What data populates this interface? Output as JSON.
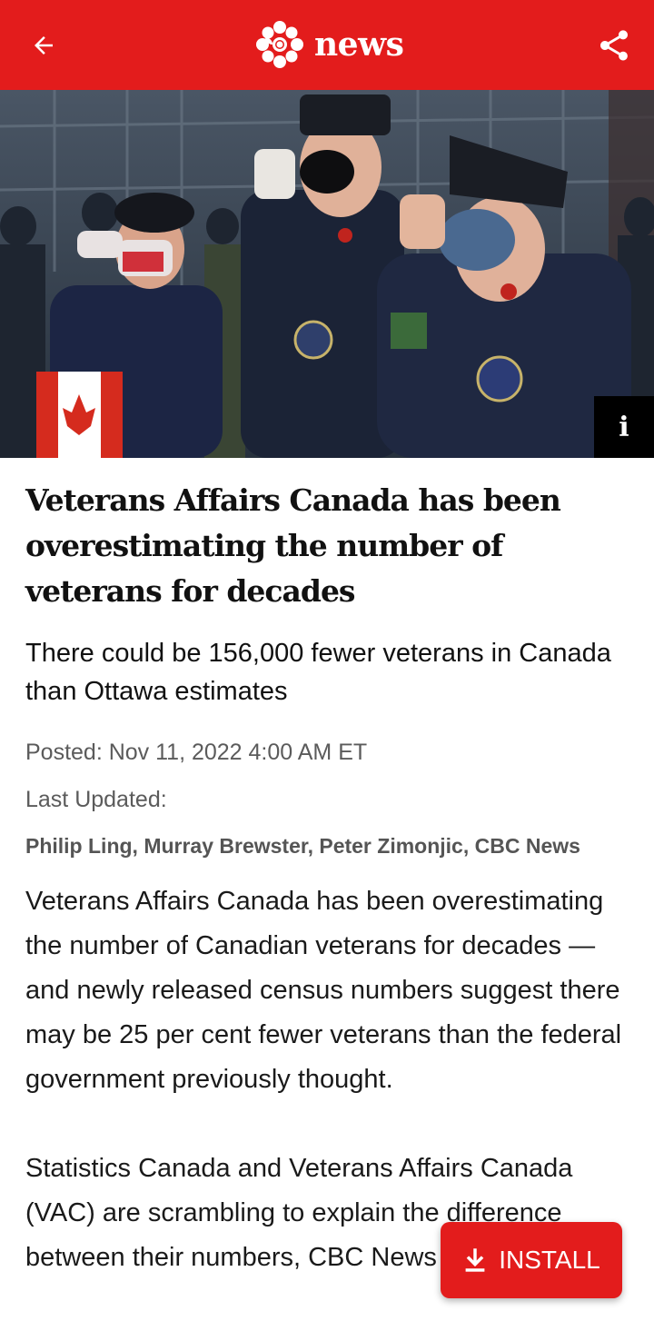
{
  "header": {
    "brand": "news",
    "back_icon": "arrow-left-icon",
    "share_icon": "share-icon",
    "logo_icon": "cbc-gem-icon",
    "background_color": "#e31c1c"
  },
  "hero": {
    "info_label": "i"
  },
  "article": {
    "headline": "Veterans Affairs Canada has been overestimating the number of veterans for decades",
    "dek": "There could be 156,000 fewer veterans in Canada than Ottawa estimates",
    "posted": "Posted: Nov 11, 2022 4:00 AM ET",
    "last_updated": "Last Updated:",
    "byline": "Philip Ling, Murray Brewster, Peter Zimonjic, CBC News",
    "paragraphs": [
      "Veterans Affairs Canada has been overestimating the number of Canadian veterans for decades — and newly released census numbers suggest there may be 25 per cent fewer veterans than the federal government previously thought.",
      "Statistics Canada and Veterans Affairs Canada (VAC) are scrambling to explain the difference between their numbers, CBC News"
    ]
  },
  "install_button": {
    "label": "INSTALL",
    "icon": "download-icon"
  }
}
